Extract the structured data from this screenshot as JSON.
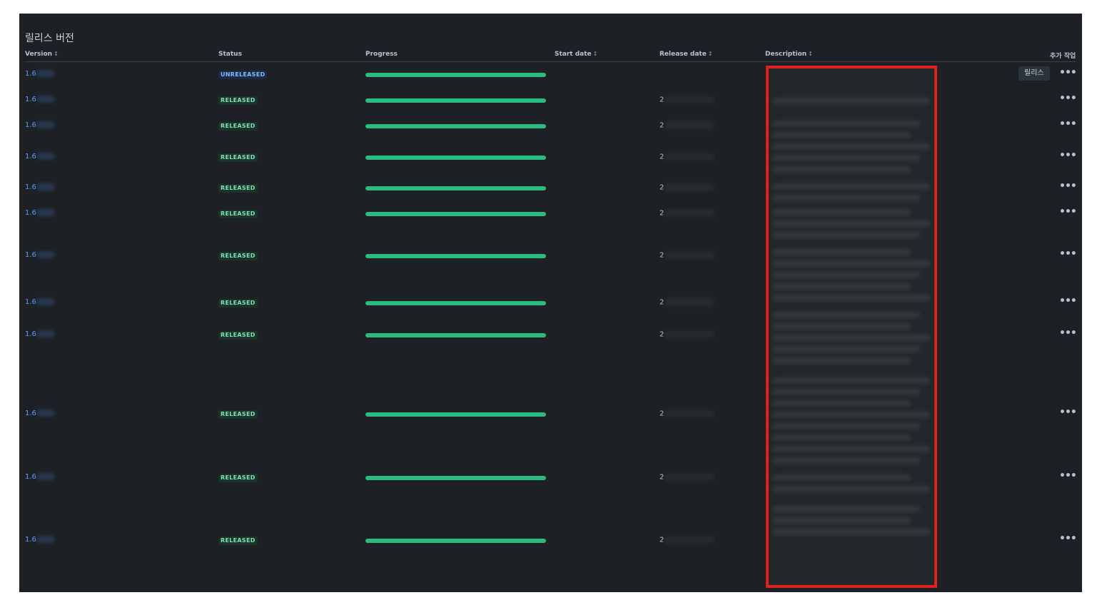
{
  "page": {
    "title": "릴리스 버전",
    "columns": {
      "version": "Version",
      "status": "Status",
      "progress": "Progress",
      "start_date": "Start date",
      "release_date": "Release date",
      "description": "Description",
      "actions": "추가 작업"
    },
    "sort_icon": "sort-icon",
    "release_button": "릴리스",
    "more_icon": "•••",
    "accent_color": "#579dff",
    "progress_color": "#2abb7f",
    "highlight_color": "#e0201d"
  },
  "rows": [
    {
      "version": "1.6",
      "status": "UNRELEASED",
      "progress": 1.0,
      "release_date": ""
    },
    {
      "version": "1.6",
      "status": "RELEASED",
      "progress": 1.0,
      "release_date": "2"
    },
    {
      "version": "1.6",
      "status": "RELEASED",
      "progress": 1.0,
      "release_date": "2"
    },
    {
      "version": "1.6",
      "status": "RELEASED",
      "progress": 1.0,
      "release_date": "2"
    },
    {
      "version": "1.6",
      "status": "RELEASED",
      "progress": 1.0,
      "release_date": "2"
    },
    {
      "version": "1.6",
      "status": "RELEASED",
      "progress": 1.0,
      "release_date": "2"
    },
    {
      "version": "1.6",
      "status": "RELEASED",
      "progress": 1.0,
      "release_date": "2"
    },
    {
      "version": "1.6",
      "status": "RELEASED",
      "progress": 1.0,
      "release_date": "2"
    },
    {
      "version": "1.6",
      "status": "RELEASED",
      "progress": 1.0,
      "release_date": "2"
    },
    {
      "version": "1.6",
      "status": "RELEASED",
      "progress": 1.0,
      "release_date": "2"
    },
    {
      "version": "1.6",
      "status": "RELEASED",
      "progress": 1.0,
      "release_date": "2"
    },
    {
      "version": "1.6",
      "status": "RELEASED",
      "progress": 1.0,
      "release_date": "2"
    }
  ]
}
